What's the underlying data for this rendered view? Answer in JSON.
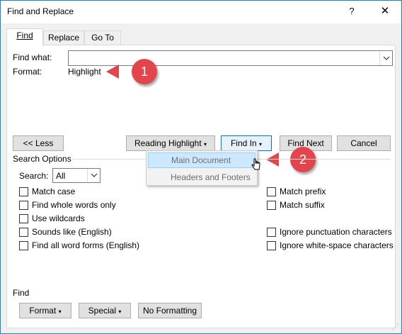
{
  "window": {
    "title": "Find and Replace",
    "help_glyph": "?",
    "close_glyph": "✕"
  },
  "tabs": [
    {
      "label": "Find",
      "active": true
    },
    {
      "label": "Replace",
      "active": false
    },
    {
      "label": "Go To",
      "active": false
    }
  ],
  "find": {
    "label": "Find what:",
    "value": "",
    "format_label": "Format:",
    "format_value": "Highlight"
  },
  "callouts": [
    "1",
    "2"
  ],
  "buttons": {
    "less": "<< Less",
    "reading_highlight": "Reading Highlight",
    "find_in": "Find In",
    "find_next": "Find Next",
    "cancel": "Cancel"
  },
  "find_in_menu": {
    "items": [
      {
        "label": "Main Document",
        "highlighted": true
      },
      {
        "label": "Headers and Footers",
        "highlighted": false
      }
    ]
  },
  "search_options": {
    "title": "Search Options",
    "search_label": "Search:",
    "search_value": "All",
    "left_checks": [
      {
        "label": "Match case",
        "checked": false
      },
      {
        "label": "Find whole words only",
        "checked": false
      },
      {
        "label": "Use wildcards",
        "checked": false
      },
      {
        "label": "Sounds like (English)",
        "checked": false
      },
      {
        "label": "Find all word forms (English)",
        "checked": false
      }
    ],
    "right_checks": [
      {
        "label": "Match prefix",
        "checked": false
      },
      {
        "label": "Match suffix",
        "checked": false
      },
      {
        "label": "Ignore punctuation characters",
        "checked": false
      },
      {
        "label": "Ignore white-space characters",
        "checked": false
      }
    ]
  },
  "find_section": {
    "title": "Find",
    "format_btn": "Format",
    "special_btn": "Special",
    "no_formatting_btn": "No Formatting"
  },
  "colors": {
    "accent": "#0078d7",
    "callout": "#e4454c",
    "menu_highlight": "#cce8ff"
  }
}
